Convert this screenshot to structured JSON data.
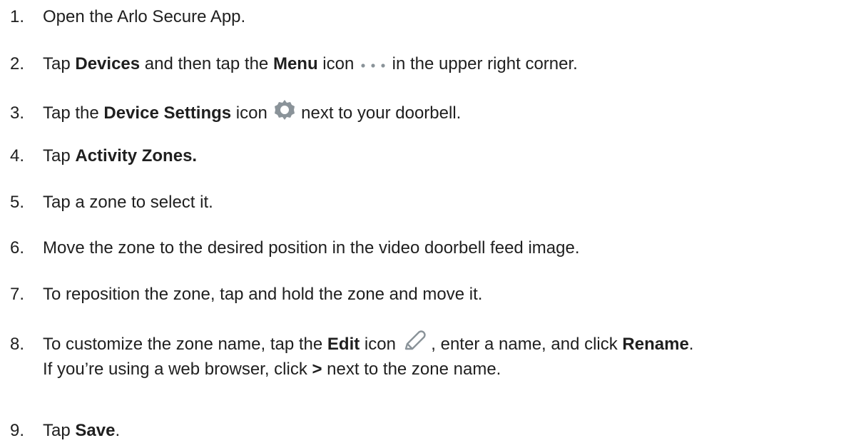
{
  "steps": [
    {
      "num": "1.",
      "text": "Open the Arlo Secure App."
    },
    {
      "num": "2.",
      "t1": "Tap ",
      "b1": "Devices",
      "t2": " and then tap the ",
      "b2": "Menu",
      "t3": " icon ",
      "t4": " in the  upper right corner.",
      "icon": "more-dots-icon"
    },
    {
      "num": "3.",
      "t1": "Tap the ",
      "b1": "Device Settings",
      "t2": " icon ",
      "t3": " next to your doorbell.",
      "icon": "gear-icon"
    },
    {
      "num": "4.",
      "t1": "Tap ",
      "b1": "Activity Zones."
    },
    {
      "num": "5.",
      "text": "Tap a zone to select it."
    },
    {
      "num": "6.",
      "text": "Move the zone to the desired position in the video doorbell feed image."
    },
    {
      "num": "7.",
      "text": "To reposition the zone, tap and hold the zone and move it."
    },
    {
      "num": "8.",
      "t1": "To customize the zone name, tap the ",
      "b1": "Edit",
      "t2": " icon ",
      "t3": " , enter a name, and click ",
      "b2": "Rename",
      "t4": ".",
      "icon": "pencil-icon",
      "line2_t1": "If you’re using a web browser, click ",
      "line2_b1": ">",
      "line2_t2": " next to the zone name."
    },
    {
      "num": "9.",
      "t1": "Tap ",
      "b1": "Save",
      "t2": "."
    }
  ],
  "colors": {
    "text": "#1f1f1f",
    "icon": "#8a9399"
  }
}
